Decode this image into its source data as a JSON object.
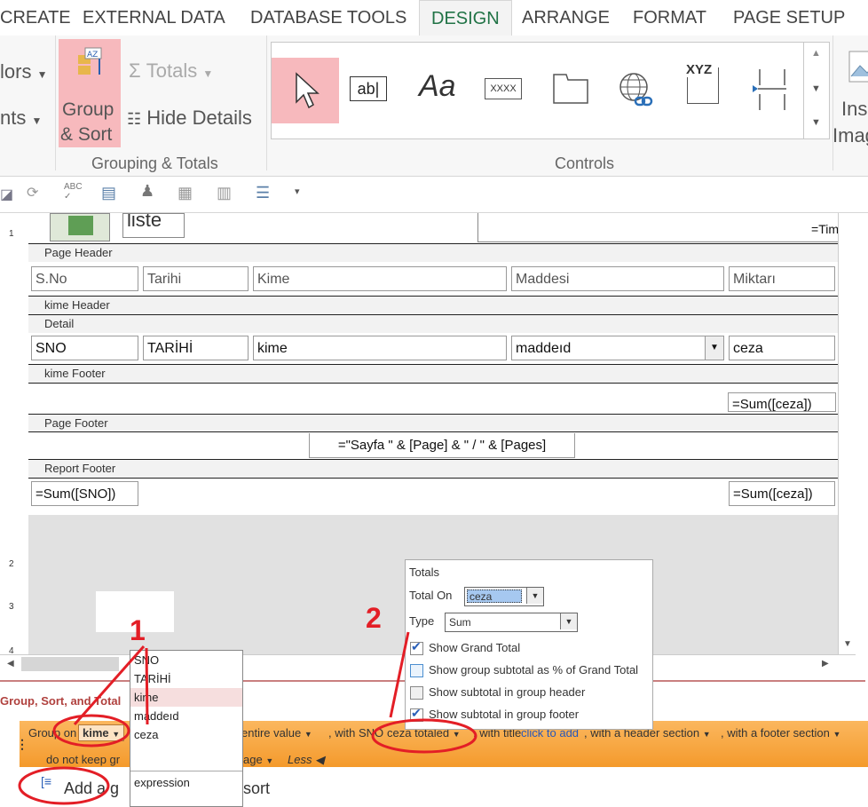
{
  "ribbon_tabs": [
    "CREATE",
    "EXTERNAL DATA",
    "DATABASE TOOLS",
    "DESIGN",
    "ARRANGE",
    "FORMAT",
    "PAGE SETUP"
  ],
  "ribbon": {
    "left_cut_1": "lors",
    "left_cut_2": "nts",
    "group_sort_1": "Group",
    "group_sort_2": "& Sort",
    "totals": "Totals",
    "hide_details": "Hide Details",
    "grouping_label": "Grouping & Totals",
    "controls_label": "Controls",
    "textbox_glyph": "ab|",
    "label_glyph": "Aa",
    "xxxx_glyph": "XXXX",
    "xyz_glyph": "XYZ",
    "insert_1": "Ins",
    "insert_2": "Imag"
  },
  "design": {
    "top_text": "liste",
    "time_field": "=Tim",
    "sections": {
      "page_header": "Page Header",
      "kime_header": "kime Header",
      "detail": "Detail",
      "kime_footer": "kime Footer",
      "page_footer": "Page Footer",
      "report_footer": "Report Footer"
    },
    "header_labels": [
      "S.No",
      "Tarihi",
      "Kime",
      "Maddesi",
      "Miktarı"
    ],
    "detail_fields": [
      "SNO",
      "TARİHİ",
      "kime",
      "maddeıd",
      "ceza"
    ],
    "kime_footer_sum": "=Sum([ceza])",
    "page_footer_expr": "=\"Sayfa \" & [Page] & \" / \" & [Pages]",
    "report_sum_sno": "=Sum([SNO])",
    "report_sum_ceza": "=Sum([ceza])"
  },
  "group_sort": {
    "title": "Group, Sort, and Total",
    "group_on": "Group on",
    "group_field": "kime",
    "entire_value": "entire value",
    "with_sno": ", with SNO",
    "ceza_totaled": "ceza totaled",
    "with_title": ", with title",
    "click_to_add": "click to add",
    "header_section": ", with a header section",
    "footer_section": ", with a footer section",
    "do_not_keep": "do not keep gr",
    "page": "age",
    "less": "Less",
    "add_group": "Add a g",
    "add_sort": "sort"
  },
  "field_dropdown": {
    "items": [
      "SNO",
      "TARİHİ",
      "kime",
      "maddeıd",
      "ceza"
    ],
    "selected": "kime",
    "expression": "expression"
  },
  "totals_panel": {
    "title": "Totals",
    "total_on_label": "Total On",
    "total_on_value": "ceza",
    "type_label": "Type",
    "type_value": "Sum",
    "options": [
      {
        "label": "Show Grand Total",
        "checked": true
      },
      {
        "label": "Show group subtotal as % of Grand Total",
        "checked": false
      },
      {
        "label": "Show subtotal in group header",
        "checked": false
      },
      {
        "label": "Show subtotal in group footer",
        "checked": true
      }
    ]
  },
  "annotations": {
    "marker_1": "1",
    "marker_2": "2"
  },
  "colors": {
    "accent_green": "#217346",
    "highlight_pink": "#f7b9bd",
    "annotation_red": "#e31e26",
    "orange_bar": "#f49a2c"
  }
}
